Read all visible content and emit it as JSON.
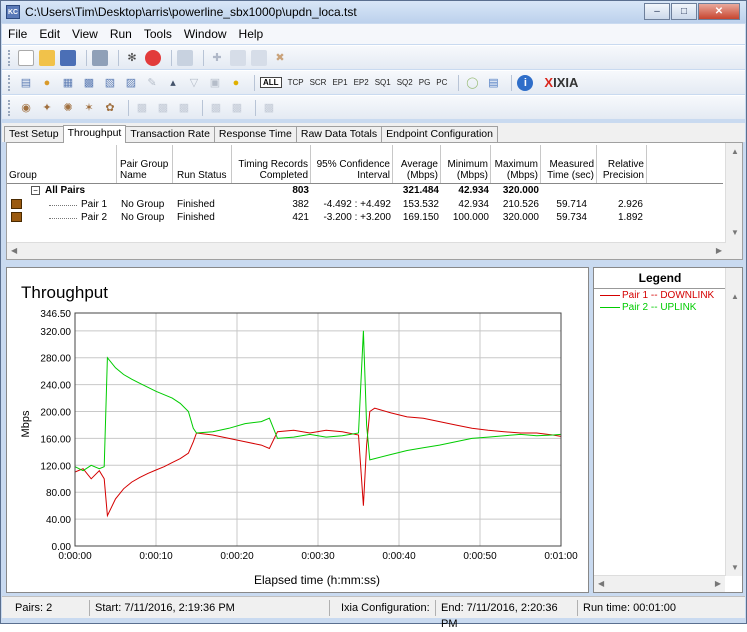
{
  "window": {
    "title": "C:\\Users\\Tim\\Desktop\\arris\\powerline_sbx1000p\\updn_loca.tst",
    "icon_text": "KC"
  },
  "menu": [
    "File",
    "Edit",
    "View",
    "Run",
    "Tools",
    "Window",
    "Help"
  ],
  "toolbar2_labels": [
    "ALL",
    "TCP",
    "SCR",
    "EP1",
    "EP2",
    "SQ1",
    "SQ2",
    "PG",
    "PC"
  ],
  "logo": {
    "x": "X",
    "text": "IXIA"
  },
  "tabs": [
    "Test Setup",
    "Throughput",
    "Transaction Rate",
    "Response Time",
    "Raw Data Totals",
    "Endpoint Configuration"
  ],
  "active_tab": "Throughput",
  "grid": {
    "headers": [
      "Group",
      "Pair Group Name",
      "Run Status",
      "Timing Records Completed",
      "95% Confidence Interval",
      "Average (Mbps)",
      "Minimum (Mbps)",
      "Maximum (Mbps)",
      "Measured Time (sec)",
      "Relative Precision"
    ],
    "header_lines": {
      "group": "Group",
      "pgn1": "Pair Group",
      "pgn2": "Name",
      "rs": "Run Status",
      "trc1": "Timing Records",
      "trc2": "Completed",
      "ci1": "95% Confidence",
      "ci2": "Interval",
      "avg1": "Average",
      "avg2": "(Mbps)",
      "min1": "Minimum",
      "min2": "(Mbps)",
      "max1": "Maximum",
      "max2": "(Mbps)",
      "mt1": "Measured",
      "mt2": "Time (sec)",
      "rp1": "Relative",
      "rp2": "Precision"
    },
    "all_pairs": {
      "label": "All Pairs",
      "records": "803",
      "avg": "321.484",
      "min": "42.934",
      "max": "320.000"
    },
    "rows": [
      {
        "pair": "Pair 1",
        "group": "No Group",
        "status": "Finished",
        "records": "382",
        "ci": "-4.492 : +4.492",
        "avg": "153.532",
        "min": "42.934",
        "max": "210.526",
        "time": "59.714",
        "precision": "2.926"
      },
      {
        "pair": "Pair 2",
        "group": "No Group",
        "status": "Finished",
        "records": "421",
        "ci": "-3.200 : +3.200",
        "avg": "169.150",
        "min": "100.000",
        "max": "320.000",
        "time": "59.734",
        "precision": "1.892"
      }
    ]
  },
  "legend": {
    "title": "Legend",
    "entries": [
      {
        "label": "Pair 1 -- DOWNLINK",
        "color": "#d40000"
      },
      {
        "label": "Pair 2 -- UPLINK",
        "color": "#00cc00"
      }
    ]
  },
  "status": {
    "pairs": "Pairs: 2",
    "start": "Start: 7/11/2016, 2:19:36 PM",
    "config": "Ixia Configuration:",
    "end": "End: 7/11/2016, 2:20:36 PM",
    "runtime": "Run time: 00:01:00"
  },
  "chart_data": {
    "type": "line",
    "title": "Throughput",
    "xlabel": "Elapsed time (h:mm:ss)",
    "ylabel": "Mbps",
    "x_ticks": [
      "0:00:00",
      "0:00:10",
      "0:00:20",
      "0:00:30",
      "0:00:40",
      "0:00:50",
      "0:01:00"
    ],
    "y_ticks": [
      "0.00",
      "40.00",
      "80.00",
      "120.00",
      "160.00",
      "200.00",
      "240.00",
      "280.00",
      "320.00",
      "346.50"
    ],
    "xlim": [
      0,
      60
    ],
    "ylim": [
      0,
      346.5
    ],
    "grid": true,
    "series": [
      {
        "name": "Pair 1 -- DOWNLINK",
        "color": "#d40000",
        "x": [
          0,
          1,
          2,
          3,
          3.6,
          4,
          5,
          6,
          7,
          8,
          9,
          10,
          11,
          12,
          13,
          14,
          14.6,
          15,
          17,
          19,
          21,
          23,
          24,
          25,
          27,
          29,
          31,
          33,
          35,
          35.6,
          36,
          36.4,
          37,
          39,
          41,
          43,
          45,
          47,
          49,
          51,
          53,
          55,
          57,
          59,
          60
        ],
        "y": [
          110,
          115,
          100,
          112,
          100,
          45,
          70,
          85,
          95,
          102,
          108,
          113,
          118,
          124,
          130,
          138,
          155,
          168,
          165,
          160,
          155,
          150,
          145,
          170,
          172,
          168,
          172,
          170,
          165,
          60,
          150,
          200,
          205,
          198,
          192,
          190,
          185,
          180,
          175,
          172,
          170,
          168,
          168,
          165,
          163
        ]
      },
      {
        "name": "Pair 2 -- UPLINK",
        "color": "#00cc00",
        "x": [
          0,
          1,
          2,
          3,
          3.6,
          4,
          5,
          6,
          7,
          8,
          9,
          10,
          11,
          12,
          13,
          14,
          14.6,
          15,
          17,
          19,
          21,
          23,
          24,
          25,
          27,
          29,
          31,
          33,
          35,
          35.6,
          36,
          36.4,
          37,
          39,
          41,
          43,
          45,
          47,
          49,
          51,
          53,
          55,
          57,
          59,
          60
        ],
        "y": [
          118,
          112,
          120,
          115,
          118,
          280,
          265,
          255,
          248,
          242,
          236,
          230,
          225,
          220,
          212,
          200,
          175,
          168,
          170,
          175,
          182,
          185,
          190,
          160,
          162,
          166,
          162,
          164,
          168,
          320,
          180,
          128,
          130,
          136,
          142,
          146,
          150,
          155,
          160,
          162,
          164,
          166,
          164,
          165,
          166
        ]
      }
    ]
  }
}
